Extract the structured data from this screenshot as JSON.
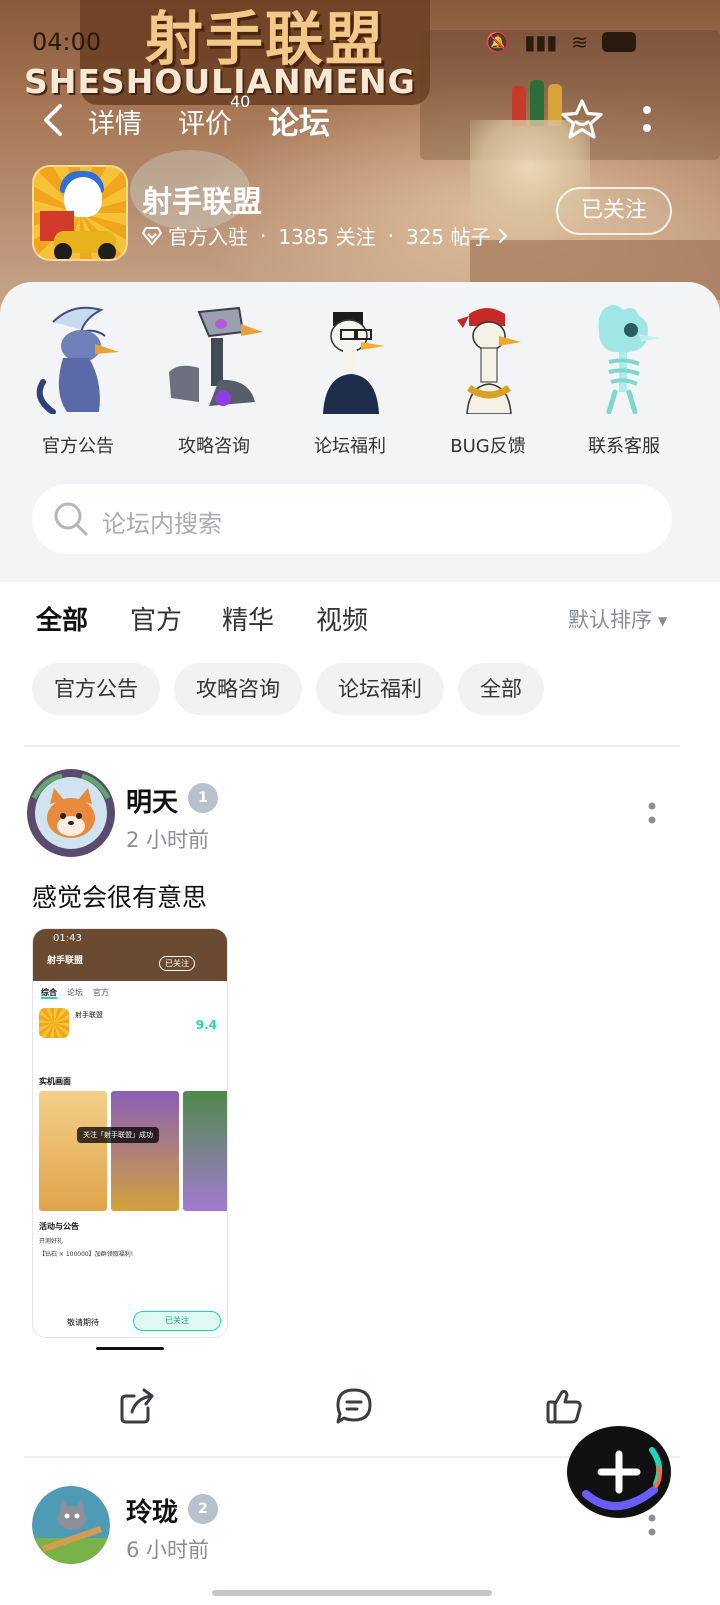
{
  "status_bar": {
    "time": "04:00",
    "battery": "3"
  },
  "header": {
    "logo_cn": "射手联盟",
    "logo_en": "SHESHOULIANMENG",
    "tabs": [
      {
        "label": "详情"
      },
      {
        "label": "评价",
        "badge": "40"
      },
      {
        "label": "论坛"
      }
    ],
    "active_tab": "论坛"
  },
  "game": {
    "title": "射手联盟",
    "official": "官方入驻",
    "followers": "1385 关注",
    "posts": "325 帖子",
    "follow_label": "已关注"
  },
  "quick_links": [
    {
      "label": "官方公告",
      "icon": "blue-heron-character"
    },
    {
      "label": "攻略咨询",
      "icon": "robot-bird-character"
    },
    {
      "label": "论坛福利",
      "icon": "glasses-goose-character"
    },
    {
      "label": "BUG反馈",
      "icon": "bandana-goose-character"
    },
    {
      "label": "联系客服",
      "icon": "ghost-skeleton-character"
    }
  ],
  "search": {
    "placeholder": "论坛内搜索"
  },
  "filter_tabs": [
    {
      "label": "全部"
    },
    {
      "label": "官方"
    },
    {
      "label": "精华"
    },
    {
      "label": "视频"
    }
  ],
  "sort_label": "默认排序",
  "chips": [
    {
      "label": "官方公告"
    },
    {
      "label": "攻略咨询"
    },
    {
      "label": "论坛福利"
    },
    {
      "label": "全部"
    }
  ],
  "posts": [
    {
      "author": "明天",
      "level": "1",
      "time": "2 小时前",
      "text": "感觉会很有意思",
      "image": {
        "time": "01:43",
        "title": "射手联盟",
        "follow": "已关注",
        "tabs": [
          "综合",
          "论坛",
          "官方"
        ],
        "score": "9.4",
        "section": "实机画面",
        "toast": "关注「射手联盟」成功",
        "activity": "活动与公告",
        "line1": "开测好礼",
        "line2": "【钻石 × 100000】加群领取福利!",
        "bottom_left": "敬请期待",
        "bottom_right": "已关注"
      }
    },
    {
      "author": "玲珑",
      "level": "2",
      "time": "6 小时前"
    }
  ],
  "colors": {
    "accent": "#1ed7b6",
    "banner": "#a77756",
    "panel": "#f3f4f6"
  }
}
